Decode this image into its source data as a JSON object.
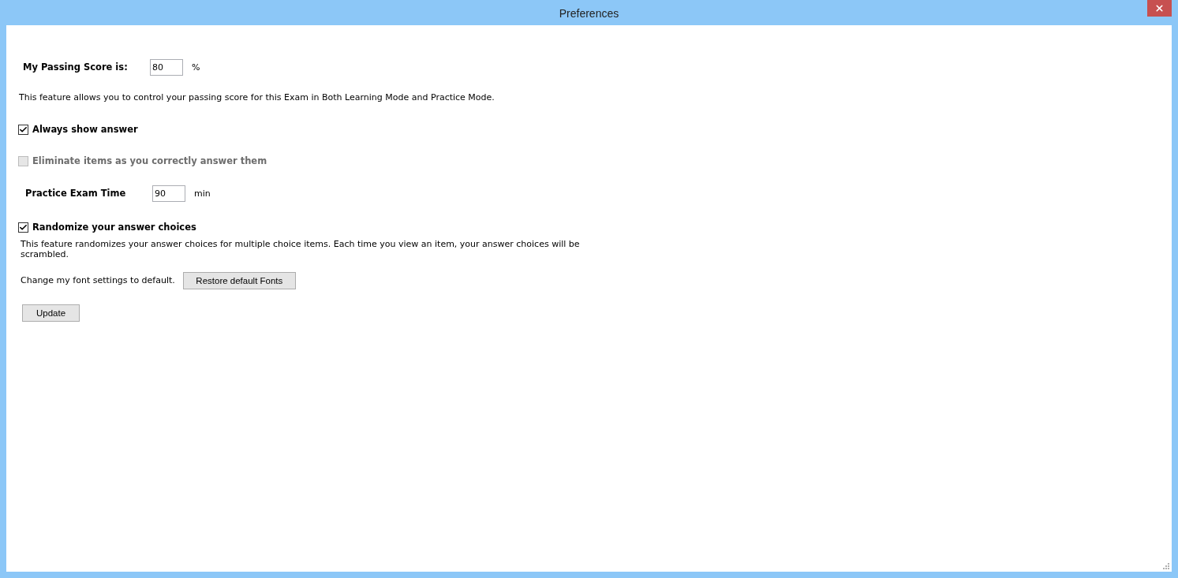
{
  "window": {
    "title": "Preferences"
  },
  "passing_score": {
    "label": "My Passing Score is:",
    "value": "80",
    "unit": "%",
    "description": "This feature allows you to control your passing score for this Exam in Both Learning Mode and Practice Mode."
  },
  "always_show_answer": {
    "label": "Always show answer",
    "checked": true,
    "disabled": false
  },
  "eliminate_items": {
    "label": "Eliminate items as you correctly answer them",
    "checked": false,
    "disabled": true
  },
  "practice_exam_time": {
    "label": "Practice Exam Time",
    "value": "90",
    "unit": "min"
  },
  "randomize": {
    "label": "Randomize your answer choices",
    "checked": true,
    "disabled": false,
    "description": "This feature randomizes your answer choices for multiple choice items. Each time you view an item, your answer choices will be scrambled."
  },
  "fonts": {
    "label": "Change my font settings to default.",
    "button": "Restore default Fonts"
  },
  "update_button": "Update"
}
